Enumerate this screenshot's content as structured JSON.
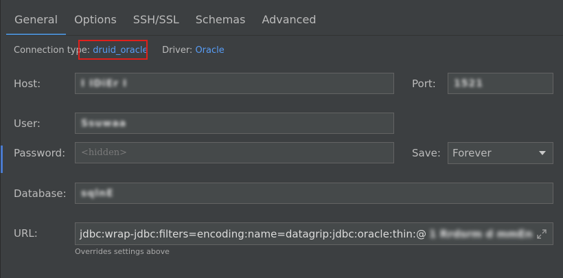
{
  "tabs": [
    {
      "label": "General",
      "active": true
    },
    {
      "label": "Options"
    },
    {
      "label": "SSH/SSL"
    },
    {
      "label": "Schemas"
    },
    {
      "label": "Advanced"
    }
  ],
  "connection": {
    "type_label": "Connection type:",
    "type_value": "druid_oracle",
    "driver_label": "Driver:",
    "driver_value": "Oracle"
  },
  "form": {
    "host_label": "Host:",
    "host_value": "I IDiEr I",
    "port_label": "Port:",
    "port_value": "1521",
    "user_label": "User:",
    "user_value": "Ssuwaa",
    "password_label": "Password:",
    "password_placeholder": "<hidden>",
    "save_label": "Save:",
    "save_value": "Forever",
    "database_label": "Database:",
    "database_value": "sqlnE",
    "url_label": "URL:",
    "url_value": "jdbc:wrap-jdbc:filters=encoding:name=datagrip:jdbc:oracle:thin:@",
    "url_masked": "1 Rrdsrm d mmEn",
    "url_hint": "Overrides settings above"
  },
  "colors": {
    "background": "#3c3f41",
    "link": "#589df6",
    "tab_underline": "#4a88c7",
    "highlight_box": "#e0201b"
  }
}
